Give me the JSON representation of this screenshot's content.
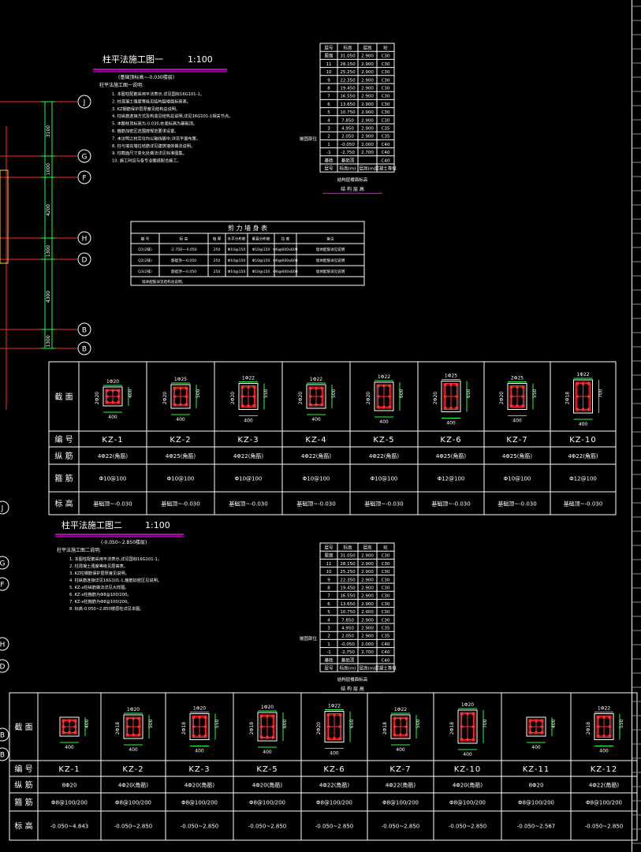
{
  "drawing1": {
    "title": "柱平法施工图一",
    "scale": "1:100",
    "subtitle": "(基础顶标高~-0.030楼层)",
    "notes_heading": "柱平法施工图一说明:",
    "notes": [
      "1. 本图柱配筋采用平法表示,详见国标16G101-1。",
      "2. 柱混凝土强度等级见结构层楼面标高表。",
      "3. KZ钢筋保护层厚度见结构总说明。",
      "4. 柱纵筋连接方式及构造见结构总说明,详见16G101-1相关节点。",
      "5. 本图柱顶标高为-0.030,柱底标高为基础顶。",
      "6. 箍筋加密区范围按规范要求设置。",
      "7. 未注明之柱定位均以轴线居中,详见平面布置。",
      "8. 柱与填充墙拉结筋详见建筑墙体做法说明。",
      "9. 柱截面尺寸变化处做法详见标准图集。",
      "10. 施工时应与各专业图纸配合施工。"
    ],
    "axis_bubbles": [
      "J",
      "G",
      "F",
      "H",
      "D",
      "B",
      "B"
    ],
    "dims": [
      "3100",
      "1000",
      "4200",
      "1300",
      "4300",
      "1300"
    ],
    "level_table": {
      "header": [
        "层号",
        "标高",
        "层高",
        "砼"
      ],
      "rows": [
        [
          "屋面",
          "31.050",
          "2.900",
          "C30"
        ],
        [
          "11",
          "28.150",
          "2.900",
          "C30"
        ],
        [
          "10",
          "25.250",
          "2.900",
          "C30"
        ],
        [
          "9",
          "22.350",
          "2.900",
          "C30"
        ],
        [
          "8",
          "19.450",
          "2.900",
          "C30"
        ],
        [
          "7",
          "16.550",
          "2.900",
          "C30"
        ],
        [
          "6",
          "13.650",
          "2.900",
          "C30"
        ],
        [
          "5",
          "10.750",
          "2.900",
          "C30"
        ],
        [
          "4",
          "7.850",
          "2.900",
          "C30"
        ],
        [
          "3",
          "4.950",
          "2.900",
          "C35"
        ],
        [
          "2",
          "2.050",
          "2.900",
          "C35"
        ],
        [
          "1",
          "-0.050",
          "2.000",
          "C40"
        ],
        [
          "-1",
          "-2.750",
          "2.700",
          "C40"
        ],
        [
          "基础",
          "基础顶",
          "",
          "C40"
        ],
        [
          "层号",
          "标高(m)",
          "层高(m)",
          "混凝土等级"
        ]
      ],
      "side_label": "嵌固部位",
      "caption1": "结构层楼面标高",
      "caption2": "结 构 层 高"
    },
    "mid_table": {
      "title": "剪 力 墙 身 表",
      "header": [
        "编 号",
        "标 高",
        "墙 厚",
        "水平分布筋",
        "垂直分布筋",
        "拉 筋",
        "备注"
      ],
      "rows": [
        [
          "Q1(2排)",
          "-2.750~-0.050",
          "250",
          "Φ10@150",
          "Φ10@150",
          "Φ6@600x600",
          "墙体配筋详见说明"
        ],
        [
          "Q2(2排)",
          "基础顶~-0.050",
          "250",
          "Φ10@150",
          "Φ10@150",
          "Φ6@600x600",
          "墙体配筋详见说明"
        ],
        [
          "Q3(2排)",
          "基础顶~-0.050",
          "250",
          "Φ10@150",
          "Φ10@150",
          "Φ6@600x600",
          "墙体配筋详见说明"
        ]
      ],
      "footnote": "墙体配筋详见结构总说明。"
    },
    "col_table": {
      "row_labels": [
        "截 面",
        "编 号",
        "纵 筋",
        "箍 筋",
        "标 高"
      ],
      "cols": [
        {
          "name": "KZ-1",
          "zj": "4Φ22(角筋)",
          "gj": "Φ10@100",
          "bg": "基础顶~-0.030",
          "top": "1Φ20",
          "side": "2Φ20",
          "w": "400",
          "h": "400"
        },
        {
          "name": "KZ-2",
          "zj": "4Φ25(角筋)",
          "gj": "Φ10@100",
          "bg": "基础顶~-0.030",
          "top": "1Φ25",
          "side": "2Φ20",
          "w": "400",
          "h": "500"
        },
        {
          "name": "KZ-3",
          "zj": "4Φ22(角筋)",
          "gj": "Φ10@100",
          "bg": "基础顶~-0.030",
          "top": "1Φ22",
          "side": "2Φ20",
          "w": "400",
          "h": "550"
        },
        {
          "name": "KZ-4",
          "zj": "4Φ22(角筋)",
          "gj": "Φ10@100",
          "bg": "基础顶~-0.030",
          "top": "1Φ22",
          "side": "2Φ20",
          "w": "400",
          "h": "500"
        },
        {
          "name": "KZ-5",
          "zj": "4Φ22(角筋)",
          "gj": "Φ10@100",
          "bg": "基础顶~-0.030",
          "top": "1Φ22",
          "side": "2Φ20",
          "w": "400",
          "h": "600"
        },
        {
          "name": "KZ-6",
          "zj": "4Φ25(角筋)",
          "gj": "Φ12@100",
          "bg": "基础顶~-0.030",
          "top": "1Φ25",
          "side": "2Φ20",
          "w": "400",
          "h": "650"
        },
        {
          "name": "KZ-7",
          "zj": "4Φ25(角筋)",
          "gj": "Φ10@100",
          "bg": "基础顶~-0.030",
          "top": "2Φ25",
          "side": "2Φ20",
          "w": "400",
          "h": "550"
        },
        {
          "name": "KZ-10",
          "zj": "4Φ22(角筋)",
          "gj": "Φ12@100",
          "bg": "基础顶~-0.030",
          "top": "1Φ22",
          "side": "2Φ18",
          "w": "400",
          "h": "700"
        }
      ]
    }
  },
  "drawing2": {
    "title": "柱平法施工图二",
    "scale": "1:100",
    "subtitle": "(-0.050~2.850楼层)",
    "notes_heading": "柱平法施工图二说明:",
    "notes": [
      "1. 本图柱配筋采用平法表示,详见国标16G101-1。",
      "2. 柱混凝土强度等级见层高表。",
      "3. KZ柱钢筋保护层厚度见说明。",
      "4. 柱纵筋连接详见16G101-1,箍筋加密区见说明。",
      "5. KZ-x柱纵筋做法详见大样图。",
      "6. KZ-x柱箍筋为Φ8@100/200。",
      "7. KZ-x柱箍筋为Φ8@100/200。",
      "8. 标高-0.050~2.850楼层柱详见本图。"
    ],
    "left_bubbles": [
      "J",
      "G",
      "F",
      "H",
      "D",
      "B",
      "B"
    ],
    "col_table": {
      "row_labels": [
        "截 面",
        "编 号",
        "纵 筋",
        "箍 筋",
        "标 高"
      ],
      "cols": [
        {
          "name": "KZ-1",
          "zj": "8Φ20",
          "gj": "Φ8@100/200",
          "bg": "-0.050~4.843",
          "top": "",
          "side": "",
          "w": "400",
          "h": "400"
        },
        {
          "name": "KZ-2",
          "zj": "4Φ20(角筋)",
          "gj": "Φ8@100/200",
          "bg": "-0.050~2.850",
          "top": "1Φ20",
          "side": "2Φ18",
          "w": "400",
          "h": "500"
        },
        {
          "name": "KZ-3",
          "zj": "4Φ20(角筋)",
          "gj": "Φ8@100/200",
          "bg": "-0.050~2.850",
          "top": "1Φ20",
          "side": "2Φ18",
          "w": "400",
          "h": "550"
        },
        {
          "name": "KZ-5",
          "zj": "4Φ20(角筋)",
          "gj": "Φ8@100/200",
          "bg": "-0.050~2.850",
          "top": "1Φ20",
          "side": "2Φ18",
          "w": "400",
          "h": "600"
        },
        {
          "name": "KZ-6",
          "zj": "4Φ22(角筋)",
          "gj": "Φ8@100/200",
          "bg": "-0.050~2.850",
          "top": "1Φ22",
          "side": "2Φ20",
          "w": "400",
          "h": "650"
        },
        {
          "name": "KZ-7",
          "zj": "4Φ22(角筋)",
          "gj": "Φ8@100/200",
          "bg": "-0.050~2.850",
          "top": "1Φ22",
          "side": "2Φ18",
          "w": "400",
          "h": "500"
        },
        {
          "name": "KZ-10",
          "zj": "4Φ20(角筋)",
          "gj": "Φ8@100/200",
          "bg": "-0.050~2.850",
          "top": "1Φ20",
          "side": "2Φ18",
          "w": "400",
          "h": "700"
        },
        {
          "name": "KZ-11",
          "zj": "8Φ20",
          "gj": "Φ8@100/200",
          "bg": "-0.050~2.567",
          "top": "",
          "side": "",
          "w": "400",
          "h": "400"
        },
        {
          "name": "KZ-12",
          "zj": "4Φ22(角筋)",
          "gj": "Φ8@100/200",
          "bg": "-0.050~2.850",
          "top": "1Φ22",
          "side": "2Φ18",
          "w": "400",
          "h": "550"
        }
      ]
    }
  },
  "colors": {
    "line": "#ffffff",
    "axis": "#ff2a2a",
    "dim": "#22ff44",
    "title_rule": "#ff00ff",
    "rebar": "#ff3030",
    "text": "#ffffff"
  }
}
